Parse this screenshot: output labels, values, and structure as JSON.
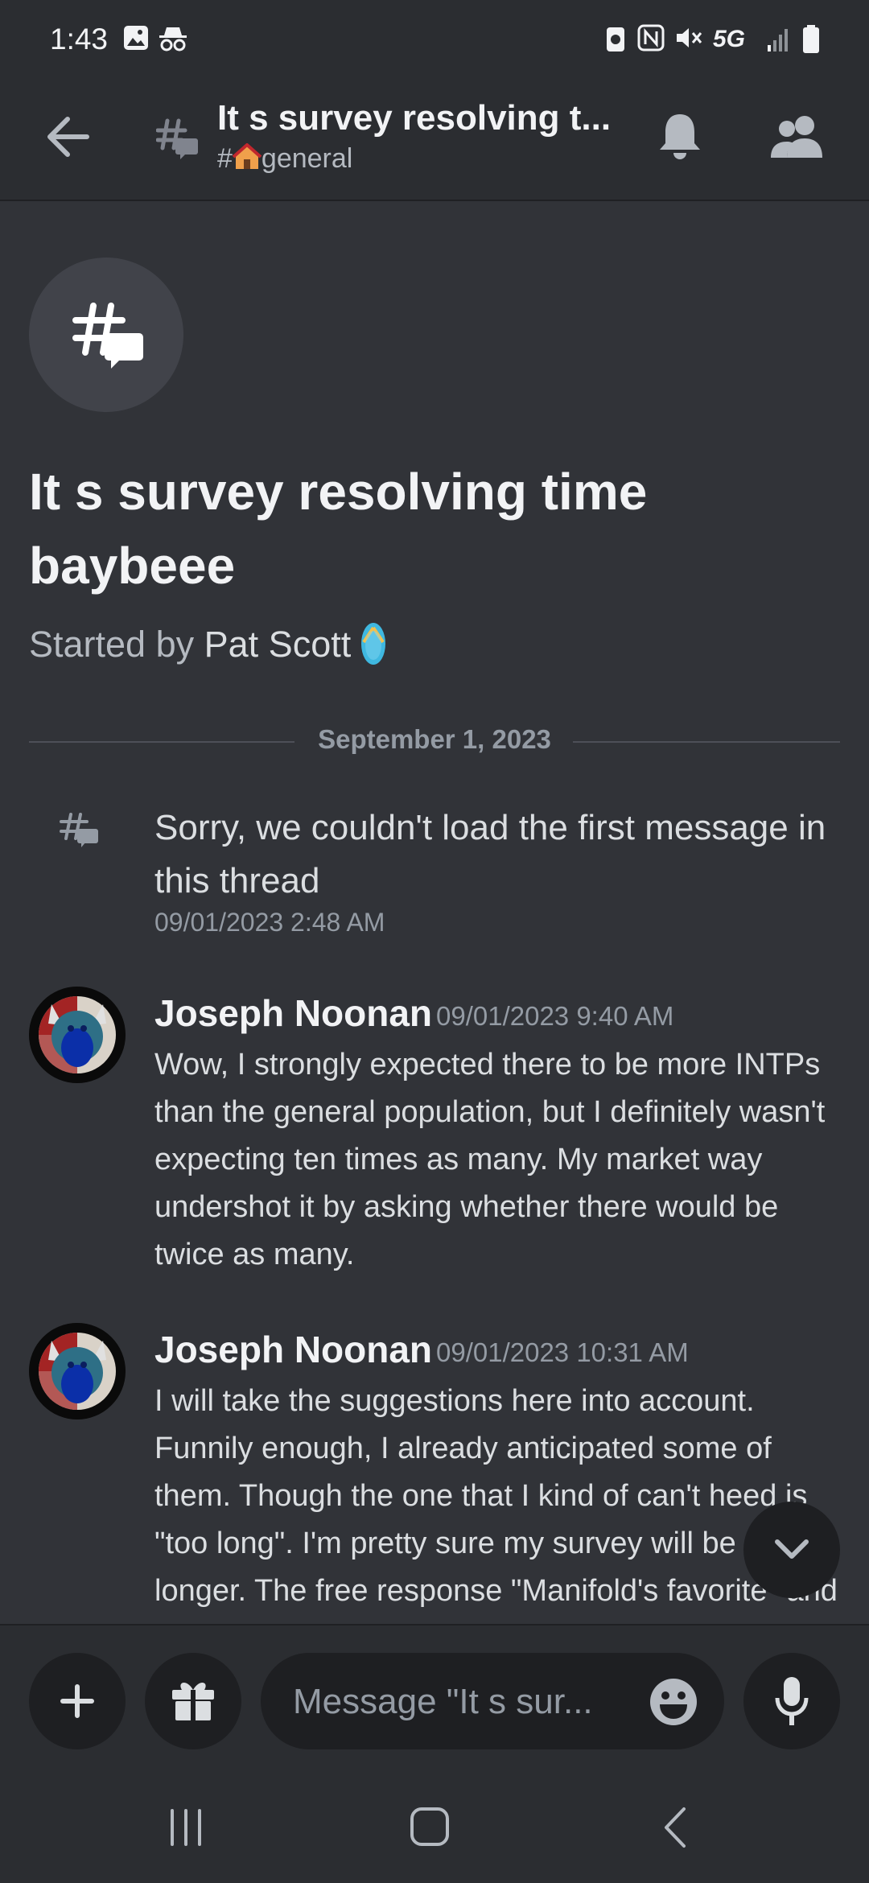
{
  "status": {
    "time": "1:43",
    "network": "5G"
  },
  "header": {
    "title": "It s survey resolving t...",
    "channel_prefix": "#",
    "channel_name": "general"
  },
  "thread": {
    "title": "It s survey resolving time baybeee",
    "started_by_prefix": "Started by",
    "author": "Pat Scott"
  },
  "date_divider": "September 1, 2023",
  "system_message": {
    "text": "Sorry, we couldn't load the first message in this thread",
    "timestamp": "09/01/2023 2:48 AM"
  },
  "messages": [
    {
      "author": "Joseph Noonan",
      "timestamp": "09/01/2023 9:40 AM",
      "body": "Wow, I strongly expected there to be more INTPs than the general population, but I definitely wasn't expecting ten times as many. My market way undershot it by asking whether there would be twice as many."
    },
    {
      "author": "Joseph Noonan",
      "timestamp": "09/01/2023 10:31 AM",
      "body": "I will take the suggestions here into account. Funnily enough, I already anticipated some of them. Though the one that I kind of can't heed is \"too long\". I'm pretty sure my survey will be even longer. The free response \"Manifold's favorite\" and stuff"
    }
  ],
  "composer": {
    "placeholder": "Message \"It s sur..."
  },
  "colors": {
    "background": "#313338",
    "header": "#2b2d31",
    "input": "#1e1f22"
  }
}
